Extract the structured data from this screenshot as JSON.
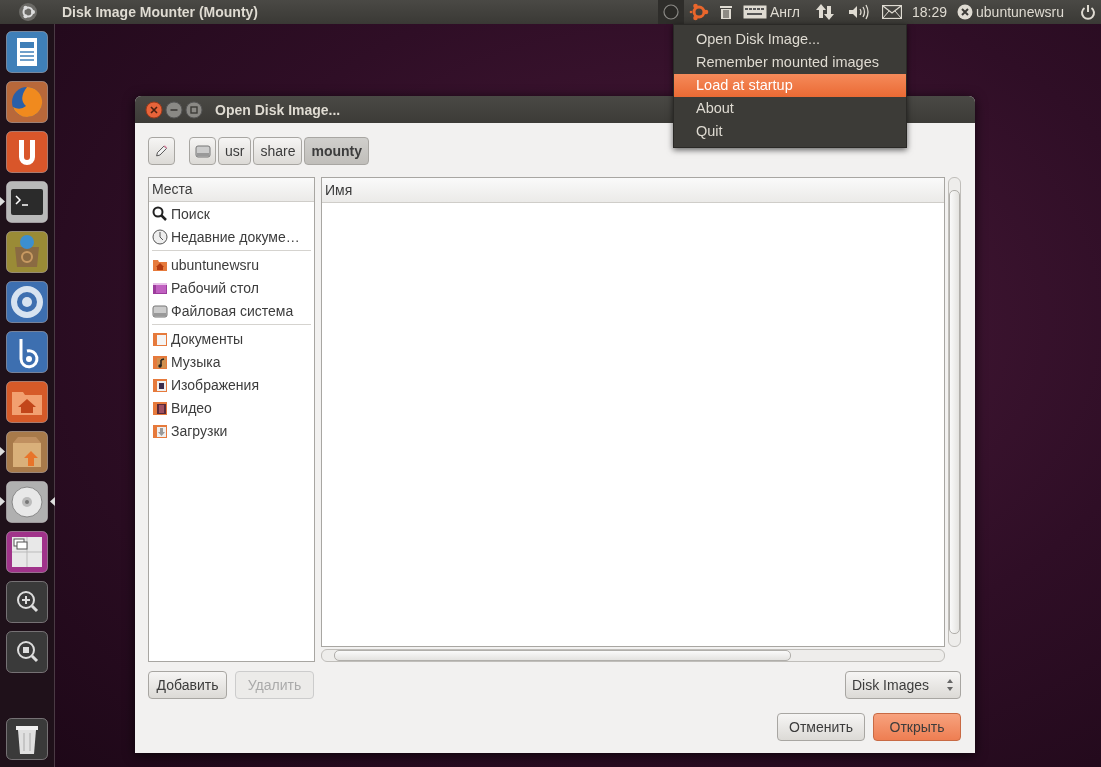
{
  "panel": {
    "title": "Disk Image Mounter (Mounty)",
    "indicator_open": true,
    "keyboard_layout": "Англ",
    "clock": "18:29",
    "user": "ubuntunewsru"
  },
  "launcher": {
    "items": [
      {
        "kind": "document",
        "running": false,
        "focused": false
      },
      {
        "kind": "browser",
        "running": false,
        "focused": false
      },
      {
        "kind": "cloud",
        "running": false,
        "focused": false
      },
      {
        "kind": "terminal",
        "running": true,
        "focused": false
      },
      {
        "kind": "software",
        "running": false,
        "focused": false
      },
      {
        "kind": "ring",
        "running": false,
        "focused": false
      },
      {
        "kind": "spiral",
        "running": false,
        "focused": false
      },
      {
        "kind": "home",
        "running": false,
        "focused": false
      },
      {
        "kind": "package",
        "running": true,
        "focused": false
      },
      {
        "kind": "disc",
        "running": true,
        "focused": true
      },
      {
        "kind": "workspaces",
        "running": false,
        "focused": false
      },
      {
        "kind": "zoom",
        "running": false,
        "focused": false
      },
      {
        "kind": "lens",
        "running": false,
        "focused": false
      }
    ],
    "trash": {
      "kind": "trash",
      "running": false,
      "focused": false
    }
  },
  "menu": {
    "items": [
      {
        "label": "Open Disk Image...",
        "selected": false
      },
      {
        "label": "Remember mounted images",
        "selected": false
      },
      {
        "label": "Load at startup",
        "selected": true
      },
      {
        "label": "About",
        "selected": false
      },
      {
        "label": "Quit",
        "selected": false
      }
    ]
  },
  "dialog": {
    "title": "Open Disk Image...",
    "path": [
      {
        "kind": "drive",
        "selected": false
      },
      {
        "label": "usr",
        "selected": false
      },
      {
        "label": "share",
        "selected": false
      },
      {
        "label": "mounty",
        "selected": true
      }
    ],
    "places": {
      "header": "Места",
      "groups": [
        [
          {
            "label": "Поиск",
            "kind": "search"
          },
          {
            "label": "Недавние докуме…",
            "kind": "recent"
          }
        ],
        [
          {
            "label": "ubuntunewsru",
            "kind": "home"
          },
          {
            "label": "Рабочий стол",
            "kind": "desktop"
          },
          {
            "label": "Файловая система",
            "kind": "drive"
          }
        ],
        [
          {
            "label": "Документы",
            "kind": "documents"
          },
          {
            "label": "Музыка",
            "kind": "music"
          },
          {
            "label": "Изображения",
            "kind": "pictures"
          },
          {
            "label": "Видео",
            "kind": "video"
          },
          {
            "label": "Загрузки",
            "kind": "downloads"
          }
        ]
      ]
    },
    "files": {
      "column": "Имя"
    },
    "place_buttons": [
      {
        "label": "Добавить",
        "disabled": false
      },
      {
        "label": "Удалить",
        "disabled": true
      }
    ],
    "filter": "Disk Images",
    "buttons": [
      {
        "label": "Отменить",
        "kind": "normal"
      },
      {
        "label": "Открыть",
        "kind": "suggested"
      }
    ]
  }
}
